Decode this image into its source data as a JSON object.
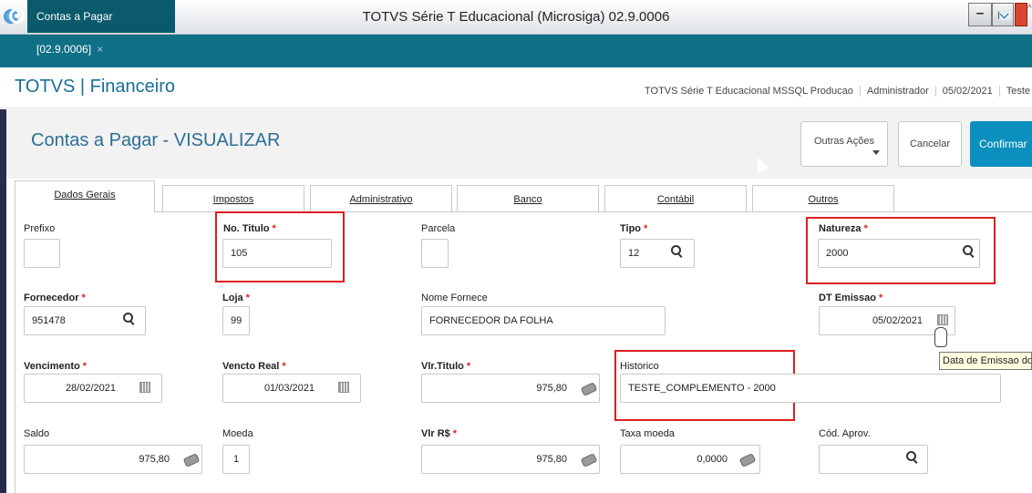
{
  "window": {
    "title": "TOTVS Série T Educacional (Microsiga) 02.9.0006",
    "min": "–",
    "max": "▢",
    "edge": "^"
  },
  "tabbar": {
    "doc_tab": "Contas a Pagar [02.9.0006]",
    "close": "×"
  },
  "header": {
    "app_title": "TOTVS | Financeiro",
    "info": [
      "TOTVS Série T Educacional MSSQL Producao",
      "Administrador",
      "05/02/2021",
      "Teste / M"
    ]
  },
  "page": {
    "title": "Contas a Pagar - VISUALIZAR",
    "outras": "Outras Ações",
    "cancelar": "Cancelar",
    "confirmar": "Confirmar"
  },
  "tabs": [
    "Dados Gerais",
    "Impostos",
    "Administrativo",
    "Banco",
    "Contábil",
    "Outros"
  ],
  "fields": {
    "prefixo": {
      "label": "Prefixo",
      "value": ""
    },
    "no_titulo": {
      "label": "No. Titulo",
      "value": "105"
    },
    "parcela": {
      "label": "Parcela",
      "value": ""
    },
    "tipo": {
      "label": "Tipo",
      "value": "12"
    },
    "natureza": {
      "label": "Natureza",
      "value": "2000"
    },
    "fornecedor": {
      "label": "Fornecedor",
      "value": "951478"
    },
    "loja": {
      "label": "Loja",
      "value": "99"
    },
    "nome_fornece": {
      "label": "Nome Fornece",
      "value": "FORNECEDOR DA FOLHA"
    },
    "dt_emissao": {
      "label": "DT Emissao",
      "value": "05/02/2021"
    },
    "vencimento": {
      "label": "Vencimento",
      "value": "28/02/2021"
    },
    "vencto_real": {
      "label": "Vencto Real",
      "value": "01/03/2021"
    },
    "vlr_titulo": {
      "label": "Vlr.Titulo",
      "value": "975,80"
    },
    "historico": {
      "label": "Historico",
      "value": "TESTE_COMPLEMENTO - 2000"
    },
    "saldo": {
      "label": "Saldo",
      "value": "975,80"
    },
    "moeda": {
      "label": "Moeda",
      "value": "1"
    },
    "vlr_rs": {
      "label": "Vlr R$",
      "value": "975,80"
    },
    "taxa_moeda": {
      "label": "Taxa moeda",
      "value": "0,0000"
    },
    "cod_aprov": {
      "label": "Cód. Aprov.",
      "value": ""
    }
  },
  "required_mark": "*",
  "tooltip": "Data de Emissao do Titulo"
}
